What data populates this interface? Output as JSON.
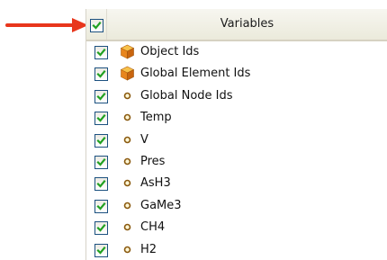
{
  "header": {
    "title": "Variables",
    "all_checked": true
  },
  "annotation": {
    "arrow_color": "#e8361c"
  },
  "colors": {
    "check_mark": "#21a121",
    "checkbox_border": "#1c5180",
    "cube_icon": "#e08a1e"
  },
  "rows": [
    {
      "label": "Object Ids",
      "checked": true,
      "icon": "cube-icon"
    },
    {
      "label": "Global Element Ids",
      "checked": true,
      "icon": "cube-icon"
    },
    {
      "label": "Global Node Ids",
      "checked": true,
      "icon": "point-icon"
    },
    {
      "label": "Temp",
      "checked": true,
      "icon": "point-icon"
    },
    {
      "label": "V",
      "checked": true,
      "icon": "point-icon"
    },
    {
      "label": "Pres",
      "checked": true,
      "icon": "point-icon"
    },
    {
      "label": "AsH3",
      "checked": true,
      "icon": "point-icon"
    },
    {
      "label": "GaMe3",
      "checked": true,
      "icon": "point-icon"
    },
    {
      "label": "CH4",
      "checked": true,
      "icon": "point-icon"
    },
    {
      "label": "H2",
      "checked": true,
      "icon": "point-icon"
    }
  ]
}
